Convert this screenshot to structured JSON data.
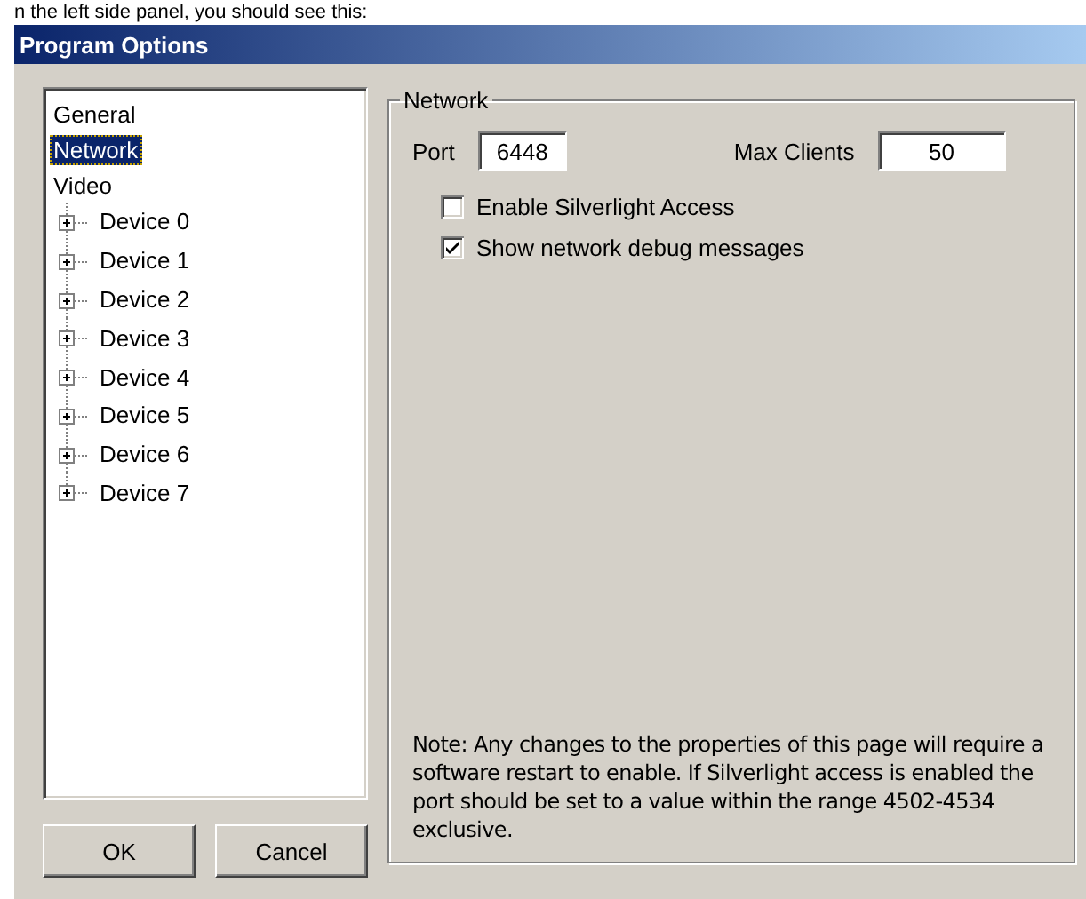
{
  "caption": "n the left side panel, you should see this:",
  "window": {
    "title": "Program Options"
  },
  "tree": {
    "items": [
      {
        "label": "General",
        "selected": false
      },
      {
        "label": "Network",
        "selected": true
      },
      {
        "label": "Video",
        "selected": false,
        "children": [
          {
            "label": "Device 0",
            "selected": false,
            "expanded": false
          },
          {
            "label": "Device 1",
            "selected": false,
            "expanded": false
          },
          {
            "label": "Device 2",
            "selected": false,
            "expanded": false
          },
          {
            "label": "Device 3",
            "selected": false,
            "expanded": false
          },
          {
            "label": "Device 4",
            "selected": false,
            "expanded": false
          },
          {
            "label": "Device 5",
            "selected": false,
            "expanded": false
          },
          {
            "label": "Device 6",
            "selected": false,
            "expanded": false
          },
          {
            "label": "Device 7",
            "selected": false,
            "expanded": false
          }
        ]
      }
    ]
  },
  "buttons": [
    "OK",
    "Cancel"
  ],
  "group": {
    "title": "Network",
    "fields": [
      {
        "label": "Port",
        "value": "6448"
      },
      {
        "label": "Max Clients",
        "value": "50"
      }
    ],
    "checkboxes": [
      {
        "label": "Enable Silverlight Access",
        "checked": false
      },
      {
        "label": "Show network debug messages",
        "checked": true
      }
    ],
    "note": "Note: Any changes to the properties of this page will require a software restart to enable. If Silverlight access is enabled the port should be set to a value within the range 4502-4534 exclusive."
  }
}
